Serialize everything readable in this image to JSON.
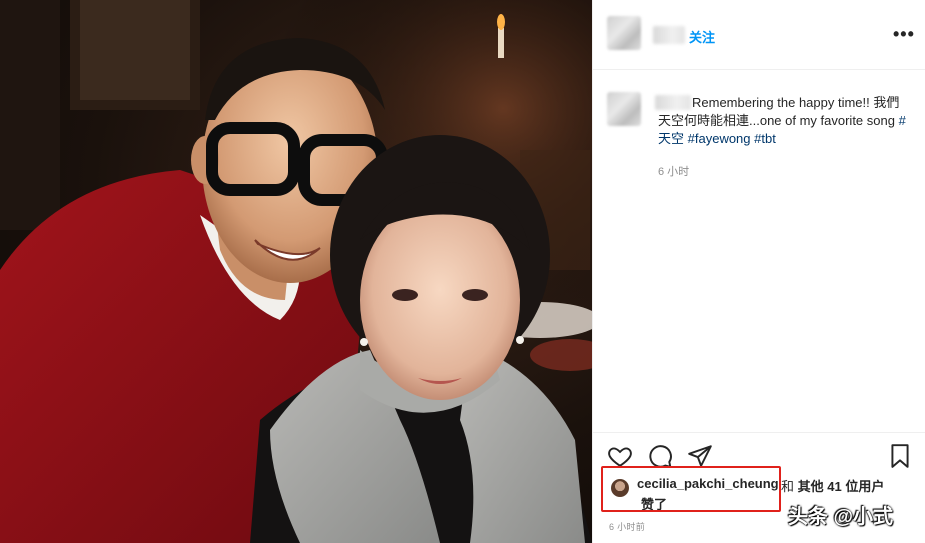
{
  "header": {
    "follow_label": "关注",
    "more_label": "•••"
  },
  "post": {
    "caption_text": "Remembering the happy time!! 我們天空何時能相連...one of my favorite song ",
    "hashtags": [
      "#天空",
      "#fayewong",
      "#tbt"
    ],
    "relative_time": "6 小时"
  },
  "likes": {
    "liker_username": "cecilia_pakchi_cheung",
    "connector": "和",
    "others_label": "其他 41 位用户",
    "suffix": "赞了"
  },
  "footer": {
    "timestamp": "6 小时前"
  },
  "watermark": {
    "text": "头条 @小式"
  },
  "icons": {
    "like": "heart-icon",
    "comment": "comment-icon",
    "share": "paper-plane-icon",
    "save": "bookmark-icon"
  },
  "colors": {
    "link": "#0095f6",
    "hashtag": "#00376b",
    "highlight": "#e0211b",
    "muted": "#8e8e8e"
  }
}
